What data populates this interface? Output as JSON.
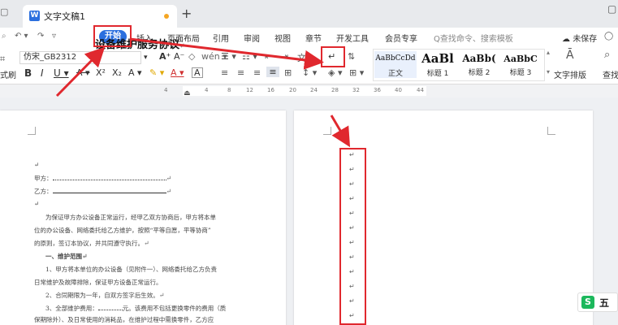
{
  "titlebar": {
    "doc_tab_title": "文字文稿1",
    "new_tab_symbol": "+",
    "app_icon_letter": "W"
  },
  "menu": {
    "items": [
      "开始",
      "插入",
      "页面布局",
      "引用",
      "审阅",
      "视图",
      "章节",
      "开发工具",
      "会员专享"
    ],
    "active": "开始",
    "search_placeholder": "Q查找命令、搜索模板",
    "unsaved": "未保存"
  },
  "ribbon": {
    "font_name": "仿宋_GB2312",
    "style_gallery": [
      {
        "preview": "AaBbCcDd",
        "caption": "正文"
      },
      {
        "preview": "AaBl",
        "caption": "标题 1"
      },
      {
        "preview": "AaBb(",
        "caption": "标题 2"
      },
      {
        "preview": "AaBbC",
        "caption": "标题 3"
      }
    ],
    "text_layout_label": "文字排版",
    "find_label": "查找",
    "left_cut_label": "式刷"
  },
  "ruler": {
    "labels": [
      "4",
      "4",
      "8",
      "12",
      "16",
      "20",
      "24",
      "28",
      "32",
      "36",
      "40",
      "44"
    ]
  },
  "document": {
    "title": "设备维护服务协议",
    "party_a": "甲方：",
    "party_b": "乙方：",
    "para1_line1": "为保证甲方办公设备正常运行，经甲乙双方协商后，甲方将本单",
    "para1_line2": "位的办公设备、网络委托给乙方维护，按照“平等自愿，平等协商”",
    "para1_line3": "的原则，签订本协议，并共同遵守执行。",
    "section1": "一、维护范围",
    "item1_line1": "1、甲方将本单位的办公设备（见附件一）、网络委托给乙方负责",
    "item1_line2": "日常维护及故障排除，保证甲方设备正常运行。",
    "item2": "2、合同期限为一年，自双方签字后生效。",
    "item3_line1": "3、全部维护费用：",
    "item3_line1b": "元。该费用不包括更换零件的费用（质",
    "item3_line2": "保期除外）、及日常使用的消耗品，在维护过程中需换零件，乙方应"
  },
  "ime": {
    "logo": "S",
    "mode": "五"
  },
  "colors": {
    "accent": "#2b6fde",
    "annotation": "#e0282e",
    "unsaved_dot": "#f5a623",
    "ime_green": "#1cb85c"
  }
}
